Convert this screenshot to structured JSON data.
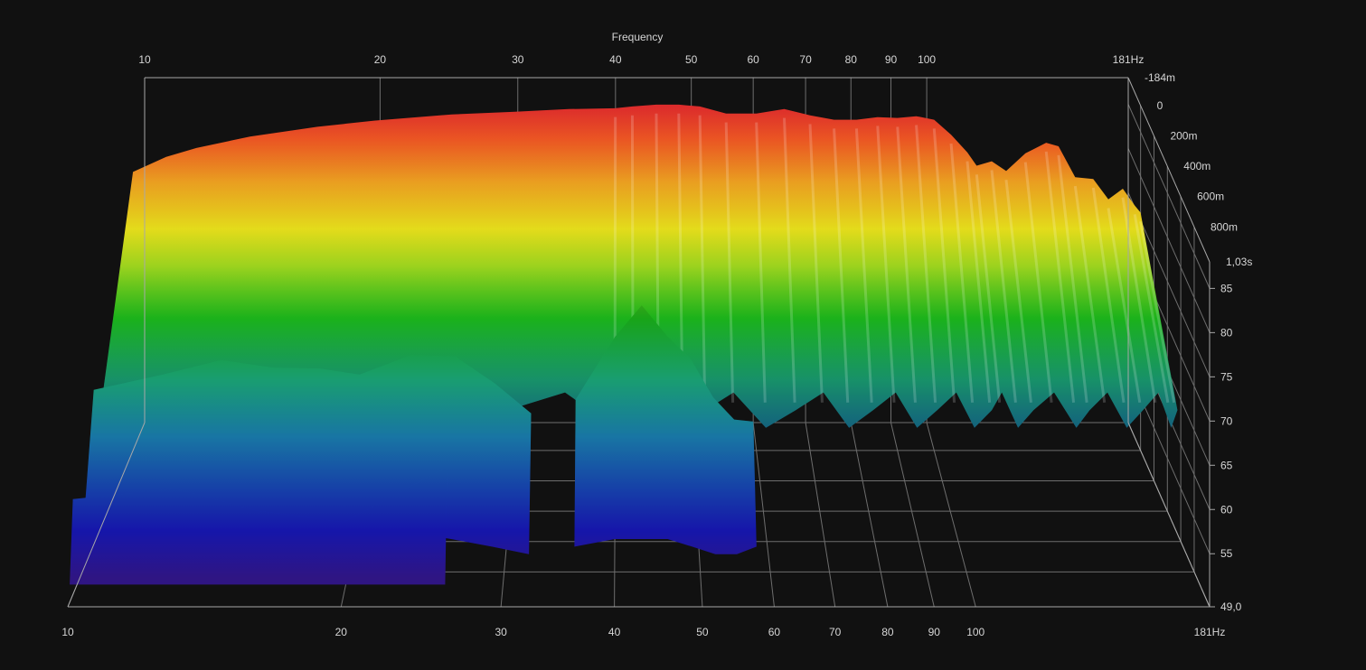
{
  "chart_data": {
    "type": "waterfall-3d",
    "title": "",
    "xlabel": "Frequency",
    "x_axis": {
      "scale": "log",
      "range": [
        10,
        181
      ],
      "ticks": [
        {
          "value": 10,
          "label": "10"
        },
        {
          "value": 20,
          "label": "20"
        },
        {
          "value": 30,
          "label": "30"
        },
        {
          "value": 40,
          "label": "40"
        },
        {
          "value": 50,
          "label": "50"
        },
        {
          "value": 60,
          "label": "60"
        },
        {
          "value": 70,
          "label": "70"
        },
        {
          "value": 80,
          "label": "80"
        },
        {
          "value": 90,
          "label": "90"
        },
        {
          "value": 100,
          "label": "100"
        },
        {
          "value": 181,
          "label": "181Hz"
        }
      ]
    },
    "time_axis": {
      "range": [
        -0.184,
        1.03
      ],
      "ticks": [
        {
          "value": -0.184,
          "label": "-184m"
        },
        {
          "value": 0,
          "label": "0"
        },
        {
          "value": 0.2,
          "label": "200m"
        },
        {
          "value": 0.4,
          "label": "400m"
        },
        {
          "value": 0.6,
          "label": "600m"
        },
        {
          "value": 0.8,
          "label": "800m"
        },
        {
          "value": 1.03,
          "label": "1,03s"
        }
      ]
    },
    "z_axis": {
      "range": [
        49,
        88
      ],
      "ticks": [
        {
          "value": 49,
          "label": "49,0"
        },
        {
          "value": 55,
          "label": "55"
        },
        {
          "value": 60,
          "label": "60"
        },
        {
          "value": 65,
          "label": "65"
        },
        {
          "value": 70,
          "label": "70"
        },
        {
          "value": 75,
          "label": "75"
        },
        {
          "value": 80,
          "label": "80"
        },
        {
          "value": 85,
          "label": "85"
        }
      ]
    },
    "colormap": [
      "#3a1aa0",
      "#1b1bd0",
      "#1e90c8",
      "#1fc08a",
      "#1ec81e",
      "#9ad21e",
      "#e8e01a",
      "#f0a01a",
      "#ee4a12",
      "#d81010"
    ],
    "surface_back": [
      [
        10,
        80.5
      ],
      [
        11,
        82.2
      ],
      [
        12,
        83.2
      ],
      [
        14,
        84.5
      ],
      [
        17,
        85.6
      ],
      [
        20,
        86.3
      ],
      [
        25,
        87.0
      ],
      [
        30,
        87.3
      ],
      [
        35,
        87.6
      ],
      [
        40,
        87.7
      ],
      [
        42,
        87.9
      ],
      [
        45,
        88.1
      ],
      [
        48,
        88.1
      ],
      [
        51,
        87.9
      ],
      [
        55,
        87.1
      ],
      [
        60,
        87.1
      ],
      [
        65,
        87.6
      ],
      [
        70,
        86.9
      ],
      [
        75,
        86.4
      ],
      [
        80,
        86.4
      ],
      [
        85,
        86.7
      ],
      [
        90,
        86.6
      ],
      [
        95,
        86.8
      ],
      [
        100,
        86.4
      ],
      [
        105,
        84.7
      ],
      [
        110,
        82.7
      ],
      [
        113,
        81.2
      ],
      [
        118,
        81.7
      ],
      [
        123,
        80.6
      ],
      [
        130,
        82.6
      ],
      [
        138,
        83.8
      ],
      [
        143,
        83.4
      ],
      [
        150,
        79.9
      ],
      [
        158,
        79.7
      ],
      [
        165,
        77.4
      ],
      [
        172,
        78.6
      ],
      [
        178,
        76.7
      ],
      [
        181,
        75.9
      ]
    ],
    "surface_front_lobes": [
      [
        10,
        0.62,
        66.5
      ],
      [
        12,
        0.62,
        68.2
      ],
      [
        14,
        0.6,
        69.5
      ],
      [
        16,
        0.55,
        67.8
      ],
      [
        18,
        0.48,
        66.5
      ],
      [
        20,
        0.45,
        65.3
      ],
      [
        23,
        0.45,
        67.5
      ],
      [
        26,
        0.5,
        68.2
      ],
      [
        29,
        0.55,
        66.0
      ],
      [
        32,
        0.6,
        63.5
      ],
      [
        10,
        0.95,
        59.8
      ],
      [
        13,
        0.95,
        61.0
      ],
      [
        16,
        0.95,
        58.5
      ],
      [
        20,
        0.95,
        57.2
      ],
      [
        23,
        0.95,
        60.5
      ],
      [
        26,
        0.9,
        62.6
      ],
      [
        36,
        0.55,
        64.2
      ],
      [
        40,
        0.5,
        70.4
      ],
      [
        43,
        0.5,
        74.0
      ],
      [
        46,
        0.5,
        70.6
      ],
      [
        49,
        0.55,
        68.8
      ],
      [
        52,
        0.6,
        65.3
      ],
      [
        55,
        0.6,
        62.8
      ],
      [
        58,
        0.55,
        61.7
      ]
    ],
    "grid": true
  }
}
